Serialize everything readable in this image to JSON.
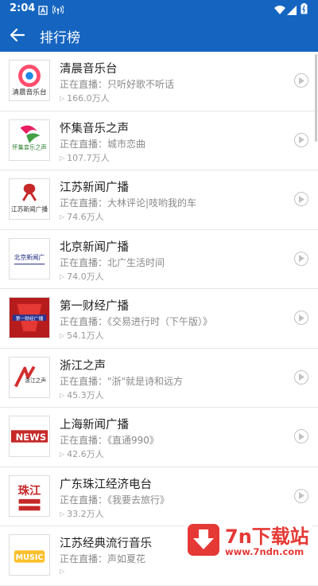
{
  "status_bar": {
    "time": "2:04"
  },
  "app_bar": {
    "title": "排行榜"
  },
  "stations": [
    {
      "name": "清晨音乐台",
      "live": "正在直播：只听好歌不听话",
      "listeners": "166.0万人",
      "logo_text": "清晨音乐台",
      "icon": "qingchen-logo"
    },
    {
      "name": "怀集音乐之声",
      "live": "正在直播：城市恋曲",
      "listeners": "107.7万人",
      "logo_text": "怀集音乐之声",
      "icon": "huaiji-logo"
    },
    {
      "name": "江苏新闻广播",
      "live": "正在直播：大林评论|吱哟我的车",
      "listeners": "74.6万人",
      "logo_text": "江苏新闻广播",
      "icon": "jiangsu-news-logo"
    },
    {
      "name": "北京新闻广播",
      "live": "正在直播：北广生活时间",
      "listeners": "74.0万人",
      "logo_text": "北京新闻广",
      "icon": "beijing-news-logo"
    },
    {
      "name": "第一财经广播",
      "live": "正在直播：《交易进行时（下午版）》",
      "listeners": "54.1万人",
      "logo_text": "第一财经广播",
      "icon": "yicai-logo"
    },
    {
      "name": "浙江之声",
      "live": "正在直播：\"浙\"就是诗和远方",
      "listeners": "45.3万人",
      "logo_text": "浙江之声",
      "icon": "zhejiang-logo"
    },
    {
      "name": "上海新闻广播",
      "live": "正在直播：《直通990》",
      "listeners": "42.6万人",
      "logo_text": "NEWS",
      "icon": "shanghai-news-logo"
    },
    {
      "name": "广东珠江经济电台",
      "live": "正在直播：《我要去旅行》",
      "listeners": "33.2万人",
      "logo_text": "珠江",
      "icon": "zhujiang-logo"
    },
    {
      "name": "江苏经典流行音乐",
      "live": "正在直播：声如夏花",
      "listeners": "",
      "logo_text": "MUSIC",
      "icon": "jiangsu-music-logo"
    }
  ],
  "watermark": {
    "title": "7n下载站",
    "url": "www.7ndn.com"
  },
  "colors": {
    "primary": "#1565c0",
    "watermark": "#e53935"
  }
}
